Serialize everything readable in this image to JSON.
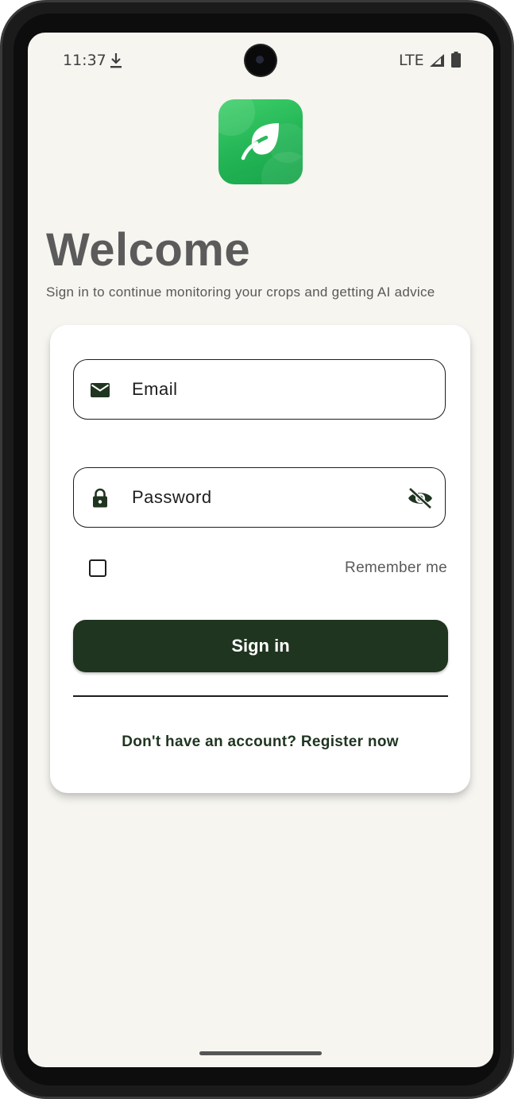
{
  "status_bar": {
    "time": "11:37",
    "network": "LTE",
    "icons": [
      "download-icon",
      "signal-icon",
      "battery-icon"
    ]
  },
  "app": {
    "logo_icon": "leaf-icon",
    "brand_color": "#22b455"
  },
  "header": {
    "title": "Welcome",
    "subtitle": "Sign in to continue monitoring your crops and getting AI advice"
  },
  "login_form": {
    "email": {
      "placeholder": "Email",
      "value": "",
      "icon": "mail-icon"
    },
    "password": {
      "placeholder": "Password",
      "value": "",
      "icon": "lock-icon",
      "visibility_icon": "eye-off-icon"
    },
    "remember_me": {
      "label": "Remember me",
      "checked": false
    },
    "signin_label": "Sign in",
    "register_text": "Don't have an account? Register now"
  },
  "colors": {
    "primary_dark": "#1f3520",
    "background": "#f6f5f0",
    "card": "#ffffff"
  }
}
